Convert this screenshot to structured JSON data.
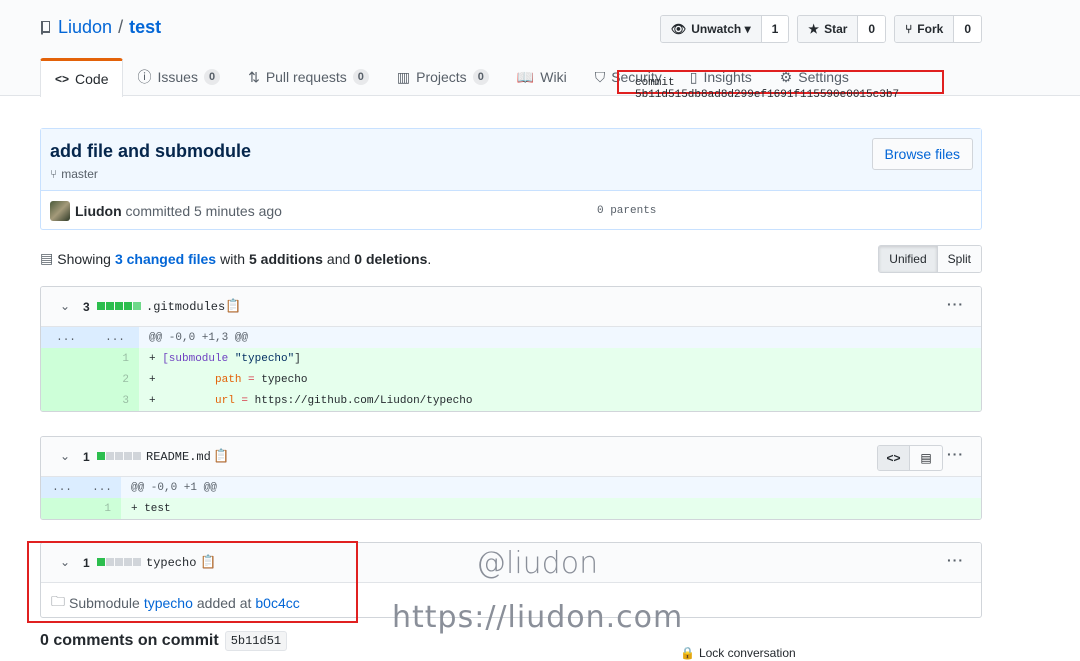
{
  "repo": {
    "owner": "Liudon",
    "separator": "/",
    "name": "test"
  },
  "actions": {
    "watch": {
      "label": "Unwatch ▾",
      "count": "1"
    },
    "star": {
      "label": "Star",
      "count": "0"
    },
    "fork": {
      "label": "Fork",
      "count": "0"
    }
  },
  "tabs": [
    {
      "label": "Code",
      "counter": ""
    },
    {
      "label": "Issues",
      "counter": "0"
    },
    {
      "label": "Pull requests",
      "counter": "0"
    },
    {
      "label": "Projects",
      "counter": "0"
    },
    {
      "label": "Wiki",
      "counter": ""
    },
    {
      "label": "Security",
      "counter": ""
    },
    {
      "label": "Insights",
      "counter": ""
    },
    {
      "label": "Settings",
      "counter": ""
    }
  ],
  "commit": {
    "title": "add file and submodule",
    "branch": "master",
    "browse_label": "Browse files",
    "author": "Liudon",
    "action": "committed 5 minutes ago",
    "parents": "0 parents",
    "sha_label": "commit",
    "sha": "5b11d515db8ad8d299ef1691f115590e0015c3b7"
  },
  "toc": {
    "showing": "Showing",
    "changed": "3 changed files",
    "with": "with",
    "additions": "5 additions",
    "and": "and",
    "deletions": "0 deletions",
    "period": ".",
    "unified": "Unified",
    "split": "Split"
  },
  "files": [
    {
      "count": "3",
      "name": ".gitmodules",
      "hunk": "@@ -0,0 +1,3 @@",
      "lines": [
        {
          "n": "1",
          "prefix": "+ ",
          "text_kw": "[submodule ",
          "text_str": "\"typecho\"",
          "text_end": "]"
        },
        {
          "n": "2",
          "prefix": "+ ",
          "indent": "        ",
          "key": "path",
          "op": " = ",
          "val": "typecho"
        },
        {
          "n": "3",
          "prefix": "+ ",
          "indent": "        ",
          "key": "url",
          "op": " = ",
          "val": "https://github.com/Liudon/typecho"
        }
      ]
    },
    {
      "count": "1",
      "name": "README.md",
      "hunk": "@@ -0,0 +1 @@",
      "lines": [
        {
          "n": "1",
          "prefix": "+ ",
          "text": "test"
        }
      ]
    },
    {
      "count": "1",
      "name": "typecho",
      "submodule_pre": "Submodule",
      "submodule_link": "typecho",
      "submodule_mid": "added at",
      "submodule_sha": "b0c4cc"
    }
  ],
  "hunk_dots": "...",
  "watermark": {
    "handle": "@liudon",
    "url": "https://liudon.com"
  },
  "comments": {
    "label": "0 comments on commit",
    "sha": "5b11d51"
  },
  "lock": "Lock conversation",
  "colors": {
    "accent": "#0366d6",
    "tab_active": "#e36209",
    "add_bg": "#e6ffed",
    "highlight_red": "#e02020"
  }
}
